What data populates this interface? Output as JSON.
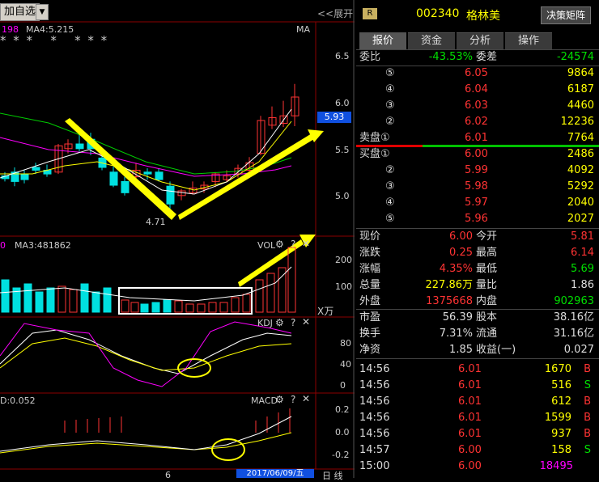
{
  "toolbar": {
    "add_fav": "加自选",
    "drop": "▼",
    "expand": "<<展开"
  },
  "main_chart": {
    "ma_legend_a": "198",
    "ma_legend_b": "MA4:5.215",
    "ma_tag": "MA",
    "stars": "* * *   *   * * *",
    "y_ticks": [
      "6.5",
      "6.0",
      "5.5",
      "5.0"
    ],
    "current_price_tag": "5.93",
    "low_label": "4.71"
  },
  "vol_chart": {
    "legend_a": "0",
    "legend_b": "MA3:481862",
    "title": "VOL",
    "unit": "X万",
    "y_ticks": [
      "200",
      "100"
    ]
  },
  "kdj_chart": {
    "title": "KDJ",
    "y_ticks": [
      "80",
      "40",
      "0"
    ]
  },
  "macd_chart": {
    "legend": "D:0.052",
    "title": "MACD",
    "y_ticks": [
      "0.2",
      "0.0",
      "-0.2"
    ]
  },
  "bottom": {
    "x_label": "6",
    "date": "2017/06/09/五",
    "period": "日 线"
  },
  "header": {
    "badge": "R",
    "code": "002340",
    "name": "格林美",
    "decision_btn": "决策矩阵"
  },
  "tabs": [
    "报价",
    "资金",
    "分析",
    "操作"
  ],
  "order_book": {
    "ratio_label": "委比",
    "ratio_value": "-43.53%",
    "diff_label": "委差",
    "diff_value": "-24574",
    "asks": [
      {
        "label": "⑤",
        "price": "6.05",
        "vol": "9864"
      },
      {
        "label": "④",
        "price": "6.04",
        "vol": "6187"
      },
      {
        "label": "③",
        "price": "6.03",
        "vol": "4460"
      },
      {
        "label": "②",
        "price": "6.02",
        "vol": "12236"
      },
      {
        "label": "卖盘①",
        "price": "6.01",
        "vol": "7764"
      }
    ],
    "bids": [
      {
        "label": "买盘①",
        "price": "6.00",
        "vol": "2486"
      },
      {
        "label": "②",
        "price": "5.99",
        "vol": "4092"
      },
      {
        "label": "③",
        "price": "5.98",
        "vol": "5292"
      },
      {
        "label": "④",
        "price": "5.97",
        "vol": "2040"
      },
      {
        "label": "⑤",
        "price": "5.96",
        "vol": "2027"
      }
    ]
  },
  "quote": [
    {
      "l1": "现价",
      "v1": "6.00",
      "l2": "今开",
      "v2": "5.81",
      "c1": "price",
      "c2": "price"
    },
    {
      "l1": "涨跌",
      "v1": "0.25",
      "l2": "最高",
      "v2": "6.14",
      "c1": "price",
      "c2": "price"
    },
    {
      "l1": "涨幅",
      "v1": "4.35%",
      "l2": "最低",
      "v2": "5.69",
      "c1": "price",
      "c2": "green"
    },
    {
      "l1": "总量",
      "v1": "227.86万",
      "l2": "量比",
      "v2": "1.86",
      "c1": "yellow",
      "c2": "white"
    },
    {
      "l1": "外盘",
      "v1": "1375668",
      "l2": "内盘",
      "v2": "902963",
      "c1": "price",
      "c2": "green"
    }
  ],
  "fundamentals": [
    {
      "l1": "市盈",
      "v1": "56.39",
      "l2": "股本",
      "v2": "38.16亿"
    },
    {
      "l1": "换手",
      "v1": "7.31%",
      "l2": "流通",
      "v2": "31.16亿"
    },
    {
      "l1": "净资",
      "v1": "1.85",
      "l2": "收益(一)",
      "v2": "0.027"
    }
  ],
  "ticks": [
    {
      "time": "14:56",
      "price": "6.01",
      "vol": "1670",
      "side": "B"
    },
    {
      "time": "14:56",
      "price": "6.01",
      "vol": "516",
      "side": "S"
    },
    {
      "time": "14:56",
      "price": "6.01",
      "vol": "612",
      "side": "B"
    },
    {
      "time": "14:56",
      "price": "6.01",
      "vol": "1599",
      "side": "B"
    },
    {
      "time": "14:56",
      "price": "6.01",
      "vol": "937",
      "side": "B"
    },
    {
      "time": "14:57",
      "price": "6.00",
      "vol": "158",
      "side": "S"
    },
    {
      "time": "15:00",
      "price": "6.00",
      "vol": "18495",
      "side": ""
    }
  ],
  "colors": {
    "up": "#ff3333",
    "down": "#00e0e0",
    "ma5": "#ffffff",
    "ma10": "#ffff00",
    "ma20": "#ff00ff",
    "ma60": "#00cc00",
    "arrow": "#ffff00"
  }
}
